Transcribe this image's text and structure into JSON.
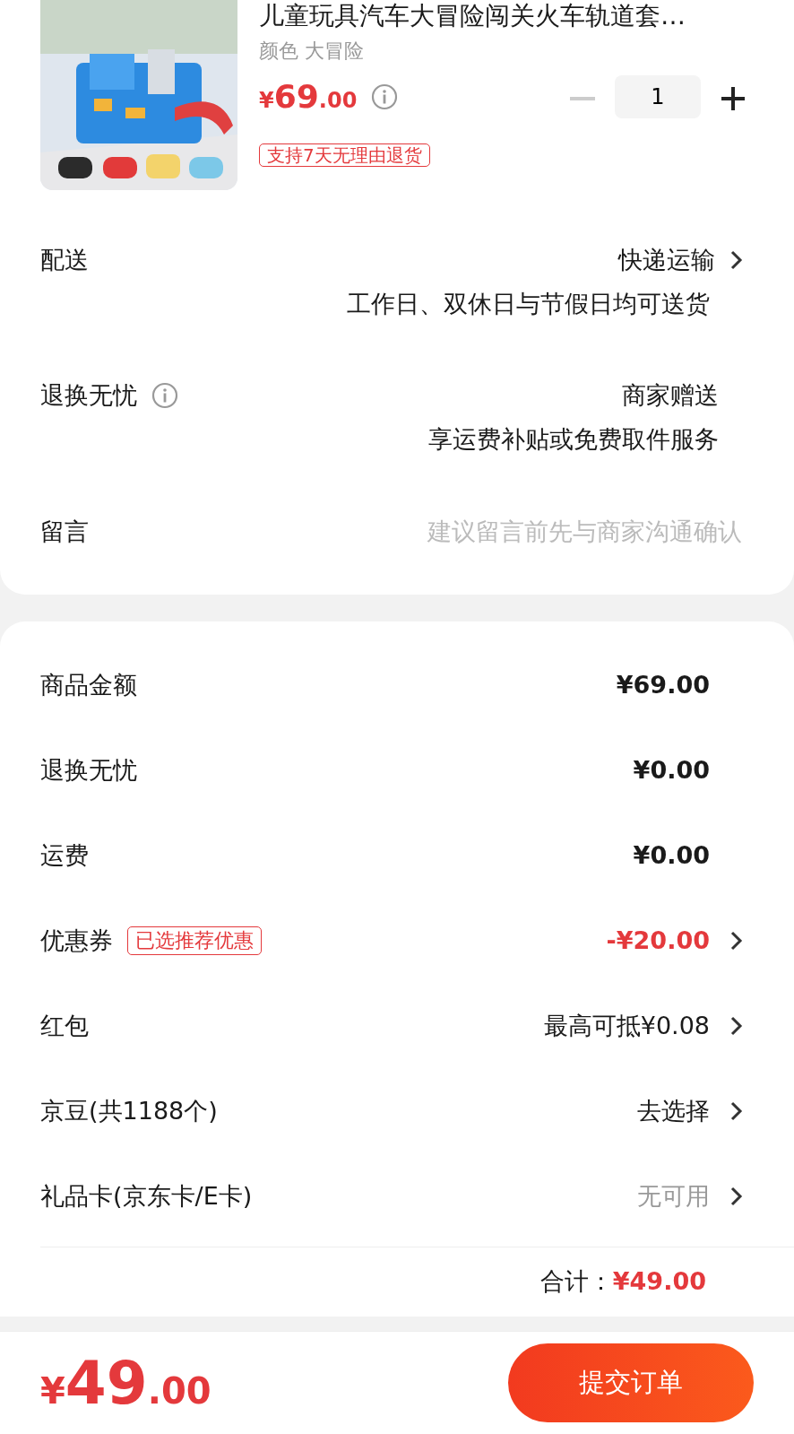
{
  "product": {
    "title": "儿童玩具汽车大冒险闯关火车轨道套…",
    "spec": "颜色 大冒险",
    "price": {
      "symbol": "¥",
      "integer": "69",
      "decimal": ".00"
    },
    "quantity": "1",
    "minus_disabled": true,
    "tag": "支持7天无理由退货"
  },
  "options": [
    {
      "kind": "delivery",
      "label": "配送",
      "value": "快递运输",
      "note": "工作日、双休日与节假日均可送货"
    },
    {
      "kind": "service",
      "label": "退换无忧",
      "value": "商家赠送",
      "note": "享运费补贴或免费取件服务"
    },
    {
      "kind": "message",
      "label": "留言",
      "placeholder": "建议留言前先与商家沟通确认"
    }
  ],
  "summary": [
    {
      "kind": "amount",
      "label": "商品金额",
      "value": "¥69.00"
    },
    {
      "kind": "amount",
      "label": "退换无忧",
      "value": "¥0.00"
    },
    {
      "kind": "amount",
      "label": "运费",
      "value": "¥0.00"
    },
    {
      "kind": "discount",
      "label": "优惠券",
      "tag": "已选推荐优惠",
      "value": "-¥20.00"
    },
    {
      "kind": "select",
      "label": "红包",
      "value": "最高可抵¥0.08"
    },
    {
      "kind": "select",
      "label": "京豆(共1188个)",
      "value": "去选择"
    },
    {
      "kind": "unavailable",
      "label": "礼品卡(京东卡/E卡)",
      "value": "无可用"
    }
  ],
  "total": {
    "label": "合计：",
    "value": "¥49.00"
  },
  "footer": {
    "price": {
      "symbol": "¥",
      "integer": "49",
      "decimal": ".00"
    },
    "submit": "提交订单"
  }
}
